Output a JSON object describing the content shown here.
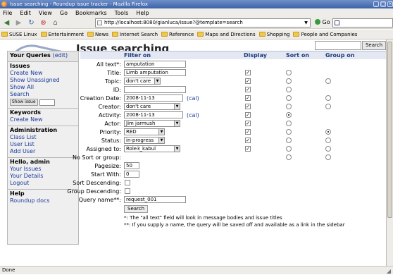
{
  "window": {
    "title": "Issue searching - Roundup issue tracker - Mozilla Firefox"
  },
  "menu": [
    "File",
    "Edit",
    "View",
    "Go",
    "Bookmarks",
    "Tools",
    "Help"
  ],
  "navbar": {
    "url": "http://localhost:8080/gianluca/issue?@template=search",
    "go_label": "Go",
    "search_value": ""
  },
  "bookmarks": [
    "SUSE Linux",
    "Entertainment",
    "News",
    "Internet Search",
    "Reference",
    "Maps and Directions",
    "Shopping",
    "People and Companies"
  ],
  "page": {
    "title": "Issue searching",
    "search_button": "Search"
  },
  "sidebar": {
    "queries_head": "Your Queries",
    "queries_edit": "(edit)",
    "issues_head": "Issues",
    "issues_links": [
      "Create New",
      "Show Unassigned",
      "Show All",
      "Search"
    ],
    "show_issue_btn": "Show issue",
    "keywords_head": "Keywords",
    "keywords_links": [
      "Create New"
    ],
    "admin_head": "Administration",
    "admin_links": [
      "Class List",
      "User List",
      "Add User"
    ],
    "user_head": "Hello, admin",
    "user_links": [
      "Your Issues",
      "Your Details",
      "Logout"
    ],
    "help_head": "Help",
    "help_links": [
      "Roundup docs"
    ]
  },
  "form": {
    "headers": {
      "filter": "Filter on",
      "display": "Display",
      "sort": "Sort on",
      "group": "Group on"
    },
    "rows": [
      {
        "label": "All text*:",
        "type": "text",
        "value": "amputation",
        "display": false,
        "sort": null,
        "group": null
      },
      {
        "label": "Title:",
        "type": "text",
        "value": "Limb amputation",
        "display": true,
        "sort": false,
        "group": null
      },
      {
        "label": "Topic:",
        "type": "select",
        "value": "don't care",
        "display": true,
        "sort": false,
        "group": false
      },
      {
        "label": "ID:",
        "type": "text",
        "value": "",
        "display": true,
        "sort": false,
        "group": null
      },
      {
        "label": "Creation Date:",
        "type": "date",
        "value": "2008-11-13",
        "display": true,
        "sort": false,
        "group": false
      },
      {
        "label": "Creator:",
        "type": "select",
        "value": "don't care",
        "display": true,
        "sort": false,
        "group": false
      },
      {
        "label": "Activity:",
        "type": "date",
        "value": "2008-11-13",
        "display": true,
        "sort": true,
        "group": null
      },
      {
        "label": "Actor:",
        "type": "select",
        "value": "Jim jarmush",
        "display": true,
        "sort": false,
        "group": null
      },
      {
        "label": "Priority:",
        "type": "select",
        "value": "RED",
        "display": true,
        "sort": false,
        "group": true
      },
      {
        "label": "Status:",
        "type": "select",
        "value": "in-progress",
        "display": true,
        "sort": false,
        "group": false
      },
      {
        "label": "Assigned to:",
        "type": "select",
        "value": "Role3_kabul",
        "display": true,
        "sort": false,
        "group": false
      },
      {
        "label": "No Sort or group:",
        "type": "none",
        "value": "",
        "display": null,
        "sort": false,
        "group": false
      }
    ],
    "cal_label": "(cal)",
    "pagesize_label": "Pagesize:",
    "pagesize_value": "50",
    "startwith_label": "Start With:",
    "startwith_value": "0",
    "sortdesc_label": "Sort Descending:",
    "groupdesc_label": "Group Descending:",
    "queryname_label": "Query name**:",
    "queryname_value": "request_001",
    "search_button": "Search",
    "note1": "*: The \"all text\" field will look in message bodies and issue titles",
    "note2": "**: If you supply a name, the query will be saved off and available as a link in the sidebar"
  },
  "status": {
    "text": "Done"
  }
}
